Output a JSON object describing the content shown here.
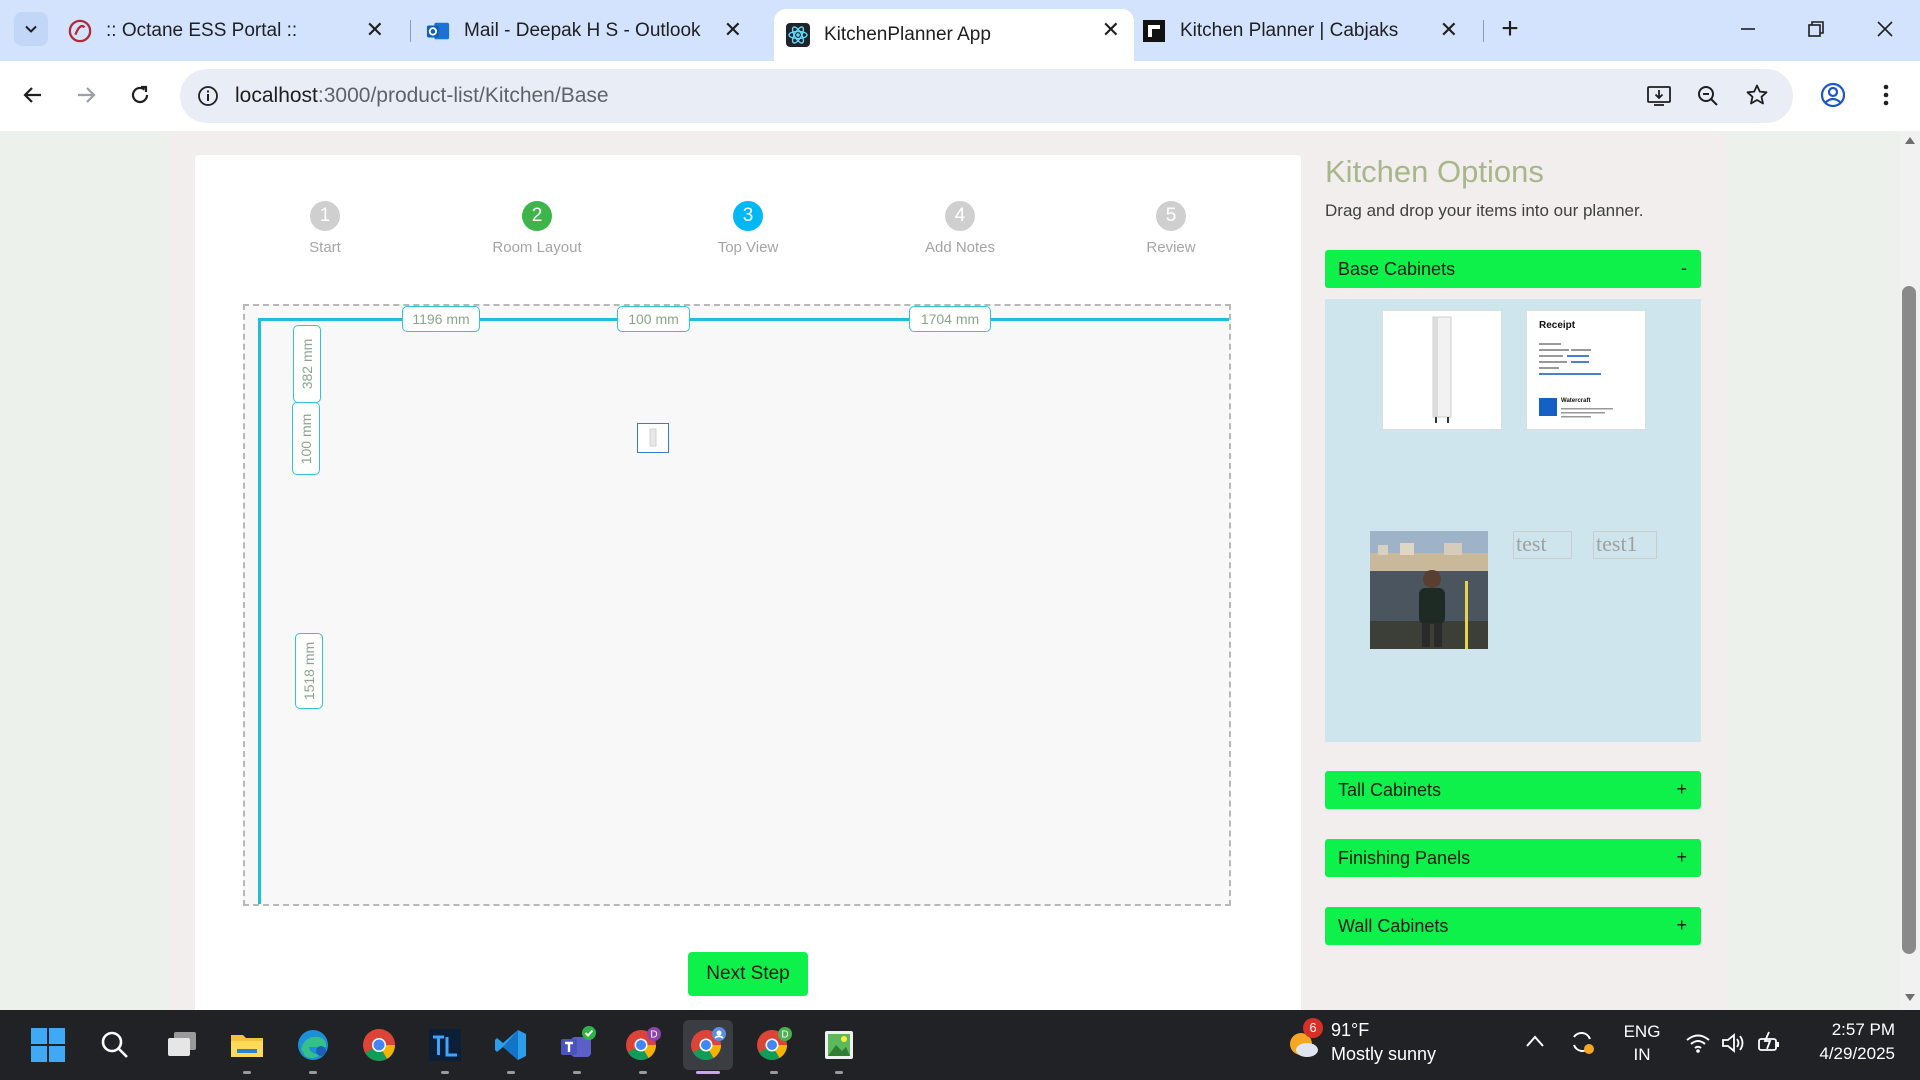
{
  "browser": {
    "tabs": [
      {
        "title": ":: Octane ESS Portal ::",
        "icon": "octane-icon",
        "active": false
      },
      {
        "title": "Mail - Deepak H S - Outlook",
        "icon": "outlook-icon",
        "active": false
      },
      {
        "title": "KitchenPlanner App",
        "icon": "react-icon",
        "active": true
      },
      {
        "title": "Kitchen Planner | Cabjaks",
        "icon": "cabjaks-icon",
        "active": false
      }
    ],
    "url_host": "localhost",
    "url_path": ":3000/product-list/Kitchen/Base"
  },
  "planner": {
    "steps": [
      {
        "number": "1",
        "label": "Start",
        "state": "done"
      },
      {
        "number": "2",
        "label": "Room Layout",
        "state": "complete"
      },
      {
        "number": "3",
        "label": "Top View",
        "state": "current"
      },
      {
        "number": "4",
        "label": "Add Notes",
        "state": "pending"
      },
      {
        "number": "5",
        "label": "Review",
        "state": "pending"
      }
    ],
    "dimensions_top": [
      "1196 mm",
      "100 mm",
      "1704 mm"
    ],
    "dimensions_left": [
      "382 mm",
      "100 mm",
      "1518 mm"
    ],
    "next_button": "Next Step"
  },
  "options": {
    "title": "Kitchen Options",
    "subtitle": "Drag and drop your items into our planner.",
    "sections": [
      {
        "label": "Base Cabinets",
        "toggle": "-",
        "expanded": true
      },
      {
        "label": "Tall Cabinets",
        "toggle": "+",
        "expanded": false
      },
      {
        "label": "Finishing Panels",
        "toggle": "+",
        "expanded": false
      },
      {
        "label": "Wall Cabinets",
        "toggle": "+",
        "expanded": false
      }
    ],
    "items": {
      "receipt_title": "Receipt",
      "receipt_brand": "Watercraft",
      "broken_alt_1": "test",
      "broken_alt_2": "test1"
    }
  },
  "taskbar": {
    "weather_badge": "6",
    "temperature": "91°F",
    "condition": "Mostly sunny",
    "language": "ENG",
    "region": "IN",
    "time": "2:57 PM",
    "date": "4/29/2025"
  },
  "colors": {
    "accent_green": "#0ef14b",
    "step_green": "#3db54a",
    "step_blue": "#00b8f5",
    "wall_cyan": "#1ec0d9",
    "title_olive": "#a7b78a"
  }
}
